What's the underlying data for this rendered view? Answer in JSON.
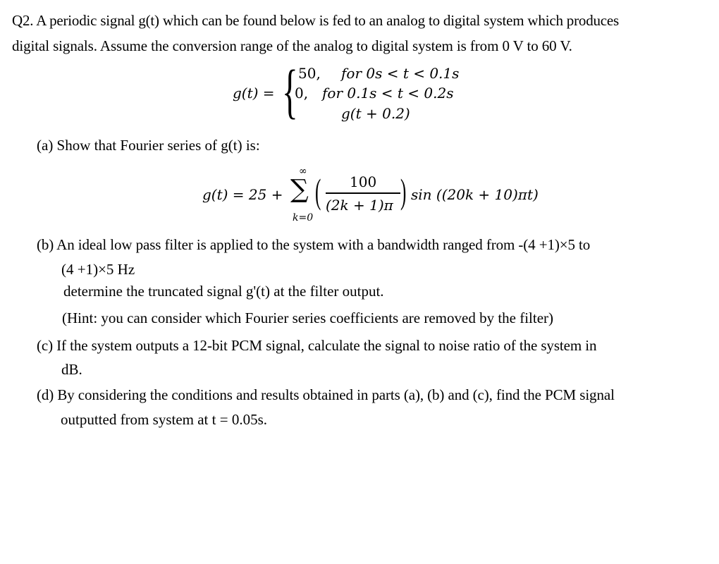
{
  "question": {
    "intro_line1": "Q2. A periodic signal g(t) which can be found below is fed to an analog to digital system which produces",
    "intro_line2": "digital signals. Assume the conversion range of the analog to digital system is from 0 V to 60 V."
  },
  "definition": {
    "lhs": "g(t) =",
    "cases": [
      {
        "value": "50,",
        "condition": "for 0s < t < 0.1s"
      },
      {
        "value": "0,",
        "condition": "for 0.1s < t < 0.2s"
      },
      {
        "value": "",
        "condition": "g(t + 0.2)"
      }
    ]
  },
  "part_a": {
    "text": "(a) Show that Fourier series of g(t) is:",
    "formula": {
      "lhs": "g(t) = 25 +",
      "sum_upper": "∞",
      "sum_symbol": "∑",
      "sum_lower": "k=0",
      "numerator": "100",
      "denominator": "(2k + 1)π",
      "trailing": "sin ((20k + 10)πt)"
    }
  },
  "part_b": {
    "line1": "(b) An ideal low pass filter is applied to the system with a bandwidth ranged from -(4 +1)×5 to",
    "line2": "(4 +1)×5 Hz",
    "line3": "determine the truncated signal g'(t) at the filter output.",
    "line4": "(Hint: you can consider which Fourier series coefficients are removed by the filter)"
  },
  "part_c": {
    "line1": "(c) If the system outputs a 12-bit PCM signal, calculate the signal to noise ratio of the system in",
    "line2": "dB."
  },
  "part_d": {
    "line1": "(d) By considering the conditions and results obtained in parts (a), (b) and (c), find the PCM signal",
    "line2": "outputted from system at t = 0.05s."
  }
}
